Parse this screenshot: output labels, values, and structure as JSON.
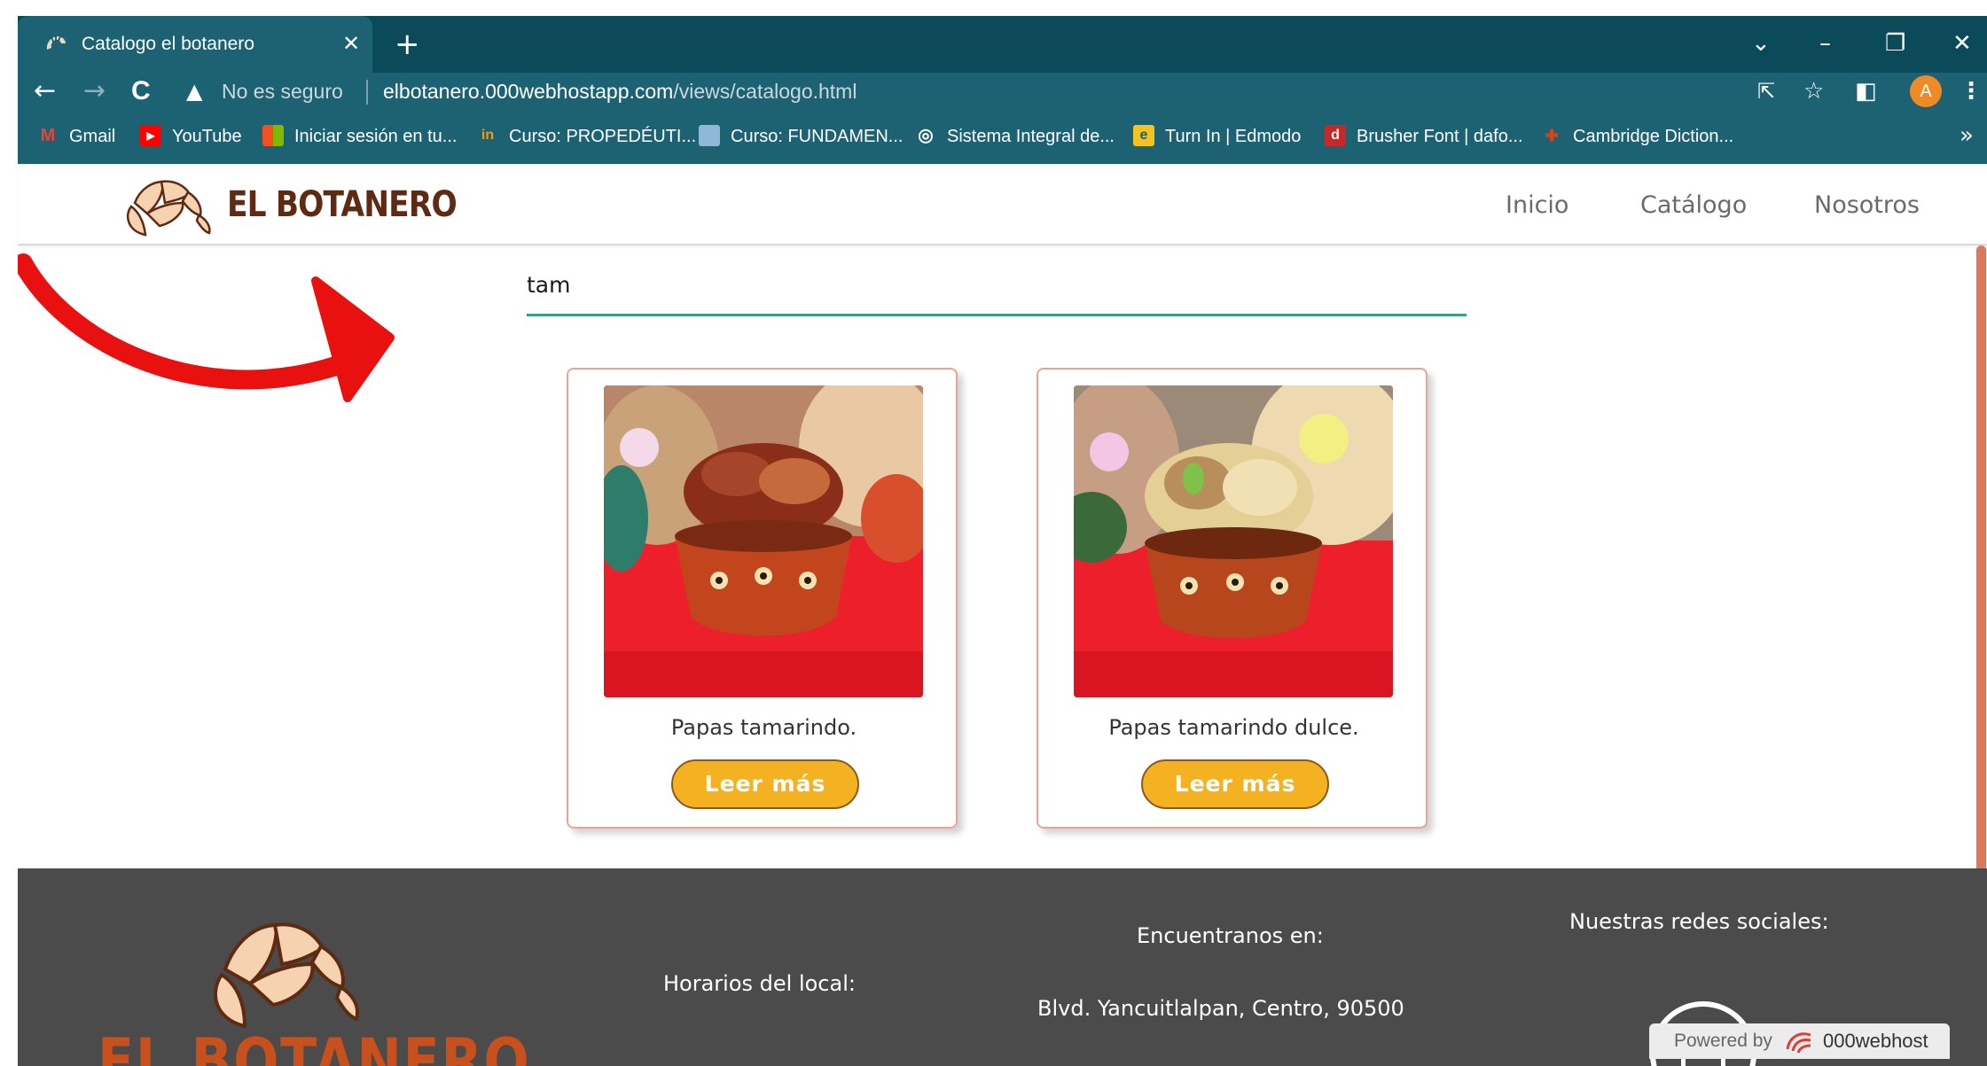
{
  "browser": {
    "tab": {
      "title": "Catalogo el botanero",
      "close": "✕",
      "new_tab": "+",
      "favicon": "croissant-favicon"
    },
    "window_controls": {
      "tab_search": "⌄",
      "minimize": "–",
      "restore": "❐",
      "close": "✕"
    },
    "nav": {
      "back": "←",
      "forward": "→",
      "reload": "C",
      "warning_icon": "▲"
    },
    "address_bar": {
      "security_label": "No es seguro",
      "host": "elbotanero.000webhostapp.com",
      "path": "/views/catalogo.html"
    },
    "toolbar_icons": {
      "share": "⇱",
      "star": "☆",
      "sidepanel": "◧",
      "profile_initial": "A",
      "menu": "⋮"
    },
    "bookmarks": [
      {
        "label": "Gmail",
        "icon": "gmail-icon",
        "glyph": "M",
        "color": "#ea4335"
      },
      {
        "label": "YouTube",
        "icon": "youtube-icon",
        "glyph": "▶",
        "color": "#ff0000"
      },
      {
        "label": "Iniciar sesión en tu...",
        "icon": "microsoft-icon",
        "glyph": "",
        "color": "#f3a51d"
      },
      {
        "label": "Curso: PROPEDÉUTI...",
        "icon": "course-icon",
        "glyph": "in",
        "color": "#f49a1a"
      },
      {
        "label": "Curso: FUNDAMEN...",
        "icon": "course-page-icon",
        "glyph": "",
        "color": "#8fb7d6"
      },
      {
        "label": "Sistema Integral de...",
        "icon": "globe-icon",
        "glyph": "◎",
        "color": "#ffffff"
      },
      {
        "label": "Turn In | Edmodo",
        "icon": "edmodo-icon",
        "glyph": "e",
        "color": "#f4c321"
      },
      {
        "label": "Brusher Font | dafo...",
        "icon": "dafont-icon",
        "glyph": "d",
        "color": "#c62828"
      },
      {
        "label": "Cambridge Diction...",
        "icon": "cambridge-icon",
        "glyph": "✚",
        "color": "#d84315"
      }
    ],
    "bookmarks_overflow": "»"
  },
  "site": {
    "brand": "EL BOTANERO",
    "nav": [
      "Inicio",
      "Catálogo",
      "Nosotros"
    ]
  },
  "search": {
    "value": "tam"
  },
  "products": [
    {
      "name": "Papas tamarindo.",
      "button": "Leer más"
    },
    {
      "name": "Papas tamarindo dulce.",
      "button": "Leer más"
    }
  ],
  "footer": {
    "brand": "EL BOTANERO",
    "hours_heading": "Horarios del local:",
    "location_heading": "Encuentranos en:",
    "address": "Blvd. Yancuitlalpan, Centro, 90500",
    "social_heading": "Nuestras redes sociales:"
  },
  "hosting_badge": {
    "prefix": "Powered by",
    "name": "000webhost"
  },
  "colors": {
    "chrome_dark": "#0b4a58",
    "chrome": "#1d6272",
    "accent_teal": "#3a9c8e",
    "button_yellow": "#f4b223",
    "footer_gray": "#4b4b4b",
    "annotation_red": "#e8110f"
  }
}
